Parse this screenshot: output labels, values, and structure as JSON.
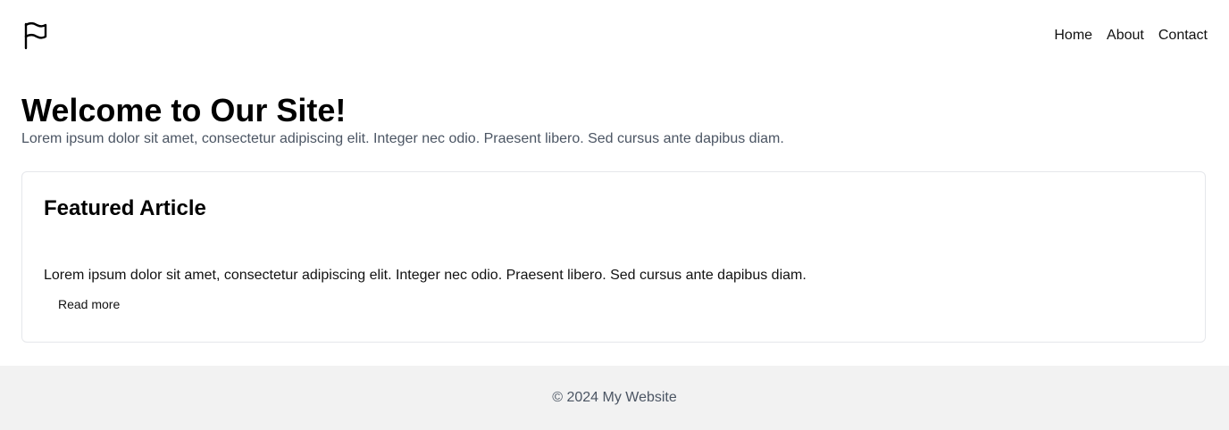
{
  "header": {
    "logo_icon": "flag-icon",
    "nav": {
      "home": "Home",
      "about": "About",
      "contact": "Contact"
    }
  },
  "hero": {
    "title": "Welcome to Our Site!",
    "subtitle": "Lorem ipsum dolor sit amet, consectetur adipiscing elit. Integer nec odio. Praesent libero. Sed cursus ante dapibus diam."
  },
  "featured": {
    "title": "Featured Article",
    "body": "Lorem ipsum dolor sit amet, consectetur adipiscing elit. Integer nec odio. Praesent libero. Sed cursus ante dapibus diam.",
    "read_more": "Read more"
  },
  "footer": {
    "copyright": "© 2024 My Website"
  },
  "colors": {
    "text": "#111111",
    "muted_text": "#4b5563",
    "card_border": "#e5e7eb",
    "footer_bg": "#f2f2f2"
  }
}
